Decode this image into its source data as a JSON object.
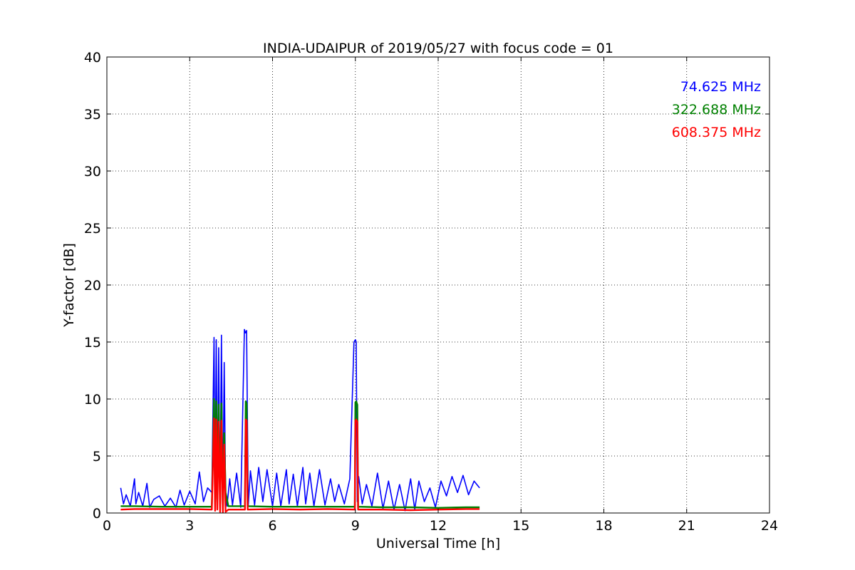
{
  "chart_data": {
    "type": "line",
    "title": "INDIA-UDAIPUR of 2019/05/27 with focus code = 01",
    "xlabel": "Universal Time [h]",
    "ylabel": "Y-factor [dB]",
    "xlim": [
      0,
      24
    ],
    "ylim": [
      0,
      40
    ],
    "xticks": [
      0,
      3,
      6,
      9,
      12,
      15,
      18,
      21,
      24
    ],
    "yticks": [
      0,
      5,
      10,
      15,
      20,
      25,
      30,
      35,
      40
    ],
    "grid": true,
    "legend_placement": "top-right",
    "series": [
      {
        "name": "74.625 MHz",
        "color": "#0000ff",
        "x": [
          0.5,
          0.6,
          0.7,
          0.85,
          1.0,
          1.05,
          1.15,
          1.3,
          1.45,
          1.55,
          1.7,
          1.9,
          2.1,
          2.3,
          2.5,
          2.65,
          2.8,
          3.0,
          3.2,
          3.35,
          3.5,
          3.65,
          3.8,
          3.88,
          3.92,
          3.96,
          4.0,
          4.05,
          4.1,
          4.15,
          4.2,
          4.25,
          4.3,
          4.35,
          4.45,
          4.55,
          4.7,
          4.85,
          4.98,
          5.02,
          5.06,
          5.12,
          5.2,
          5.35,
          5.5,
          5.65,
          5.8,
          6.0,
          6.15,
          6.3,
          6.5,
          6.6,
          6.75,
          6.9,
          7.1,
          7.2,
          7.35,
          7.5,
          7.7,
          7.9,
          8.1,
          8.25,
          8.4,
          8.6,
          8.8,
          8.95,
          9.0,
          9.03,
          9.07,
          9.12,
          9.25,
          9.4,
          9.6,
          9.8,
          10.0,
          10.2,
          10.4,
          10.6,
          10.8,
          11.0,
          11.15,
          11.3,
          11.5,
          11.7,
          11.9,
          12.1,
          12.3,
          12.5,
          12.7,
          12.9,
          13.1,
          13.3,
          13.5
        ],
        "values": [
          2.2,
          0.8,
          1.6,
          0.6,
          3.0,
          0.8,
          1.8,
          0.6,
          2.6,
          0.5,
          1.2,
          1.5,
          0.6,
          1.3,
          0.5,
          2.0,
          0.7,
          1.9,
          0.8,
          3.6,
          1.0,
          2.2,
          1.8,
          15.4,
          1.0,
          15.2,
          1.5,
          14.5,
          0.8,
          15.6,
          0.5,
          13.2,
          1.5,
          0.6,
          3.0,
          0.7,
          3.5,
          0.5,
          16.1,
          15.8,
          16.0,
          0.6,
          3.7,
          0.7,
          4.0,
          1.0,
          3.8,
          0.6,
          3.5,
          0.6,
          3.8,
          0.8,
          3.4,
          0.6,
          4.0,
          0.8,
          3.5,
          0.6,
          3.8,
          0.7,
          3.0,
          1.0,
          2.5,
          0.8,
          3.0,
          15.0,
          15.2,
          15.0,
          1.0,
          3.2,
          0.8,
          2.5,
          0.6,
          3.5,
          0.4,
          2.8,
          0.3,
          2.5,
          0.2,
          3.0,
          0.3,
          2.8,
          1.0,
          2.2,
          0.5,
          2.8,
          1.5,
          3.2,
          1.8,
          3.3,
          1.6,
          2.8,
          2.2
        ]
      },
      {
        "name": "322.688 MHz",
        "color": "#008000",
        "x": [
          0.5,
          1.0,
          2.0,
          3.0,
          3.8,
          3.88,
          3.92,
          3.96,
          4.0,
          4.05,
          4.1,
          4.15,
          4.2,
          4.25,
          4.3,
          4.4,
          5.0,
          5.03,
          5.06,
          5.1,
          6.0,
          7.0,
          8.0,
          8.98,
          9.0,
          9.03,
          9.07,
          9.1,
          10.0,
          11.0,
          12.0,
          13.0,
          13.5
        ],
        "values": [
          0.6,
          0.6,
          0.55,
          0.55,
          0.55,
          10.0,
          1.0,
          9.8,
          1.2,
          9.5,
          0.8,
          9.6,
          0.5,
          7.0,
          1.8,
          0.6,
          0.6,
          9.8,
          9.6,
          0.6,
          0.55,
          0.55,
          0.55,
          0.55,
          9.7,
          9.8,
          9.5,
          0.55,
          0.5,
          0.5,
          0.45,
          0.5,
          0.5
        ]
      },
      {
        "name": "608.375 MHz",
        "color": "#ff0000",
        "x": [
          0.5,
          1.0,
          2.0,
          3.0,
          3.8,
          3.88,
          3.92,
          3.96,
          4.0,
          4.05,
          4.1,
          4.15,
          4.2,
          4.25,
          4.3,
          4.4,
          5.0,
          5.03,
          5.06,
          5.1,
          6.0,
          7.0,
          8.0,
          8.98,
          9.0,
          9.03,
          9.07,
          9.1,
          10.0,
          11.0,
          12.0,
          13.0,
          13.5
        ],
        "values": [
          0.3,
          0.35,
          0.35,
          0.35,
          0.3,
          8.3,
          0.2,
          8.2,
          0.3,
          8.0,
          0.1,
          8.1,
          0.05,
          6.0,
          0.1,
          0.3,
          0.3,
          8.2,
          8.1,
          0.3,
          0.35,
          0.3,
          0.35,
          0.3,
          8.1,
          8.2,
          8.0,
          0.3,
          0.3,
          0.25,
          0.3,
          0.35,
          0.35
        ]
      }
    ]
  }
}
